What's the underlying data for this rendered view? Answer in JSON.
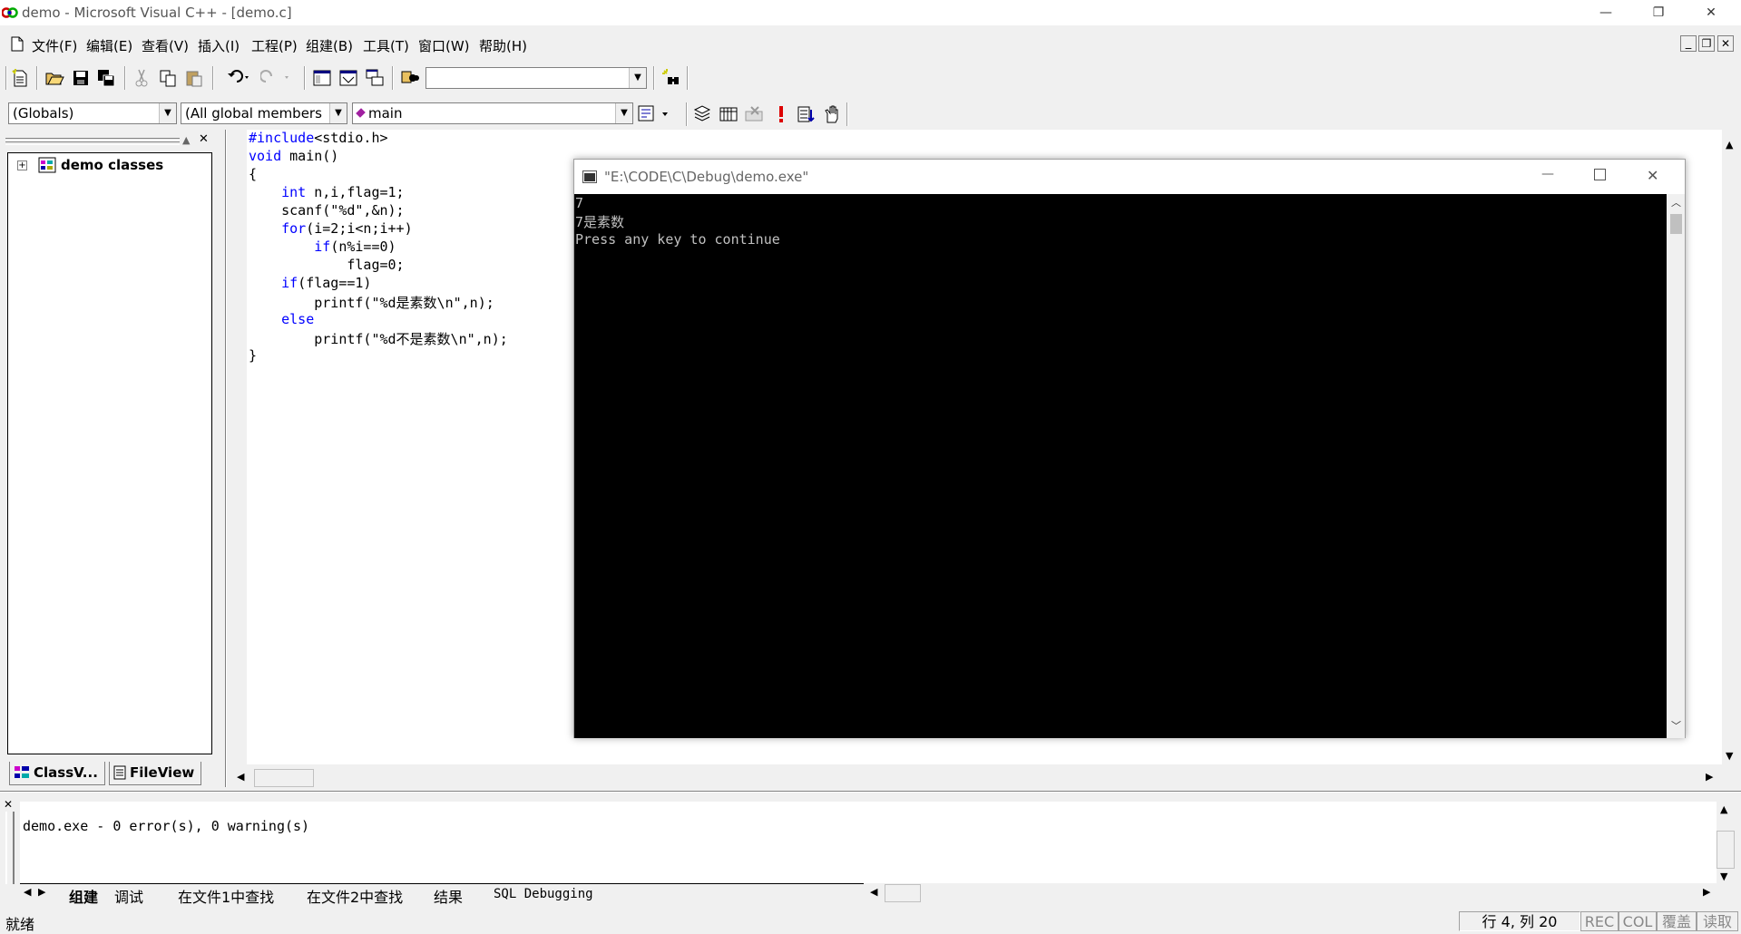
{
  "window": {
    "title": "demo - Microsoft Visual C++ - [demo.c]",
    "minimize_glyph": "—",
    "restore_glyph": "❐",
    "close_glyph": "✕"
  },
  "menu": {
    "items": [
      "文件(F)",
      "编辑(E)",
      "查看(V)",
      "插入(I)",
      "工程(P)",
      "组建(B)",
      "工具(T)",
      "窗口(W)",
      "帮助(H)"
    ],
    "mdi_controls": [
      "_",
      "❐",
      "✕"
    ]
  },
  "toolbar": {
    "find_combo_value": "",
    "icons": [
      "new-file-icon",
      "open-folder-icon",
      "save-icon",
      "save-all-icon",
      "cut-icon",
      "copy-icon",
      "paste-icon",
      "undo-icon",
      "redo-icon",
      "workspace-icon",
      "output-icon",
      "window-list-icon",
      "find-in-files-icon",
      "find-icon"
    ]
  },
  "wizardbar": {
    "scope": "(Globals)",
    "members": "(All global members",
    "function": "main",
    "build_icons": [
      "compile-icon",
      "build-icon",
      "stop-build-icon",
      "execute-icon",
      "insert-breakpoint-icon",
      "go-icon"
    ]
  },
  "workspace": {
    "tree_root": "demo classes",
    "expand_glyph": "+",
    "tabs": [
      "ClassV...",
      "FileView"
    ]
  },
  "editor": {
    "lines": [
      {
        "kw": "#include",
        "rest": "<stdio.h>"
      },
      {
        "kw": "void",
        "rest": " main()"
      },
      {
        "kw": "",
        "rest": "{"
      },
      {
        "indent": "    ",
        "kw": "int",
        "rest": " n,i,flag=1;"
      },
      {
        "indent": "    ",
        "kw": "",
        "rest": "scanf(\"%d\",&n);"
      },
      {
        "indent": "    ",
        "kw": "for",
        "rest": "(i=2;i<n;i++)"
      },
      {
        "indent": "        ",
        "kw": "if",
        "rest": "(n%i==0)"
      },
      {
        "indent": "            ",
        "kw": "",
        "rest": "flag=0;"
      },
      {
        "indent": "    ",
        "kw": "if",
        "rest": "(flag==1)"
      },
      {
        "indent": "        ",
        "kw": "",
        "rest": "printf(\"%d是素数\\n\",n);"
      },
      {
        "indent": "    ",
        "kw": "else",
        "rest": ""
      },
      {
        "indent": "        ",
        "kw": "",
        "rest": "printf(\"%d不是素数\\n\",n);"
      },
      {
        "kw": "",
        "rest": "}"
      }
    ]
  },
  "console": {
    "title": "\"E:\\CODE\\C\\Debug\\demo.exe\"",
    "lines": [
      "7",
      "7是素数",
      "Press any key to continue"
    ]
  },
  "output": {
    "message": "demo.exe - 0 error(s), 0 warning(s)",
    "tabs": [
      "组建",
      "调试",
      "在文件1中查找",
      "在文件2中查找",
      "结果",
      "SQL Debugging"
    ]
  },
  "status": {
    "ready": "就绪",
    "position": "行 4, 列 20",
    "rec": "REC",
    "col": "COL",
    "ovr": "覆盖",
    "read": "读取"
  },
  "colors": {
    "keyword": "#0000ff",
    "console_bg": "#000000",
    "console_text": "#c0c0c0"
  }
}
